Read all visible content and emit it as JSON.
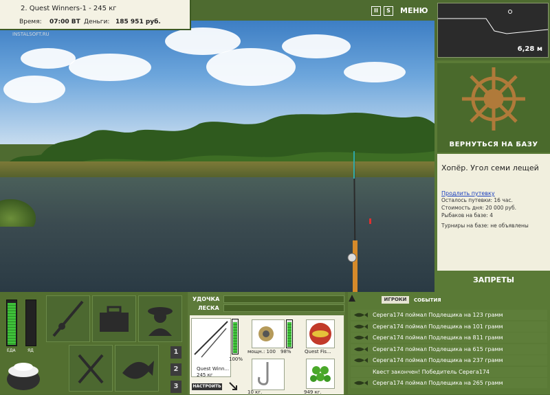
{
  "info": {
    "title": "2. Quest Winners-1 - 245 кг",
    "time_label": "Время:",
    "time_value": "07:00 ВТ",
    "money_label": "Деньги:",
    "money_value": "185 951 руб."
  },
  "watermark": "INSTALSOFT.RU",
  "top_controls": {
    "pause": "II",
    "sound": "S",
    "menu": "МЕНЮ"
  },
  "map": {
    "depth": "6,28 м"
  },
  "base": {
    "return_label": "ВЕРНУТЬСЯ НА БАЗУ",
    "place_name": "Хопёр. Угол семи лещей",
    "extend_link": "Продлить путевку",
    "lines": [
      "Осталось путевки: 16 час.",
      "Стоимость дня: 20 000 руб.",
      "Рыбаков на базе: 4",
      "Турниры на базе: не объявлены"
    ],
    "bans_label": "ЗАПРЕТЫ"
  },
  "status": {
    "food_label": "ЕДА",
    "poison_label": "ЯД",
    "food_level": 0.92,
    "poison_level": 0.0
  },
  "slots": [
    "1",
    "2",
    "3"
  ],
  "rod": {
    "rod_label": "УДОЧКА",
    "line_label": "ЛЕСКА",
    "name": "Quest Winn...",
    "weight": "245 кг",
    "durability": "100%",
    "setup_button": "НАСТРОИТЬ",
    "reel_label": "мощн.: 100",
    "reel_value": "98%",
    "lure_label": "Quest Fis...",
    "hook_label": "10 кг.",
    "bait_label": "949 кг."
  },
  "events": {
    "tab_players": "ИГРОКИ",
    "tab_events": "СОБЫТИЯ",
    "rows": [
      {
        "text": "Серега174 поймал Подлещика на 123 грамм",
        "fish": true
      },
      {
        "text": "Серега174 поймал Подлещика на 101 грамм",
        "fish": true
      },
      {
        "text": "Серега174 поймал Подлещика на 811 грамм",
        "fish": true
      },
      {
        "text": "Серега174 поймал Подлещика на 615 грамм",
        "fish": true
      },
      {
        "text": "Серега174 поймал Подлещика на 237 грамм",
        "fish": true
      },
      {
        "text": "Квест закончен! Победитель Серега174",
        "fish": false
      },
      {
        "text": "Серега174 поймал Подлещика на 265 грамм",
        "fish": true
      }
    ]
  },
  "colors": {
    "panel": "#536f30",
    "accent": "#3fc23a",
    "link": "#1a3fbf"
  }
}
